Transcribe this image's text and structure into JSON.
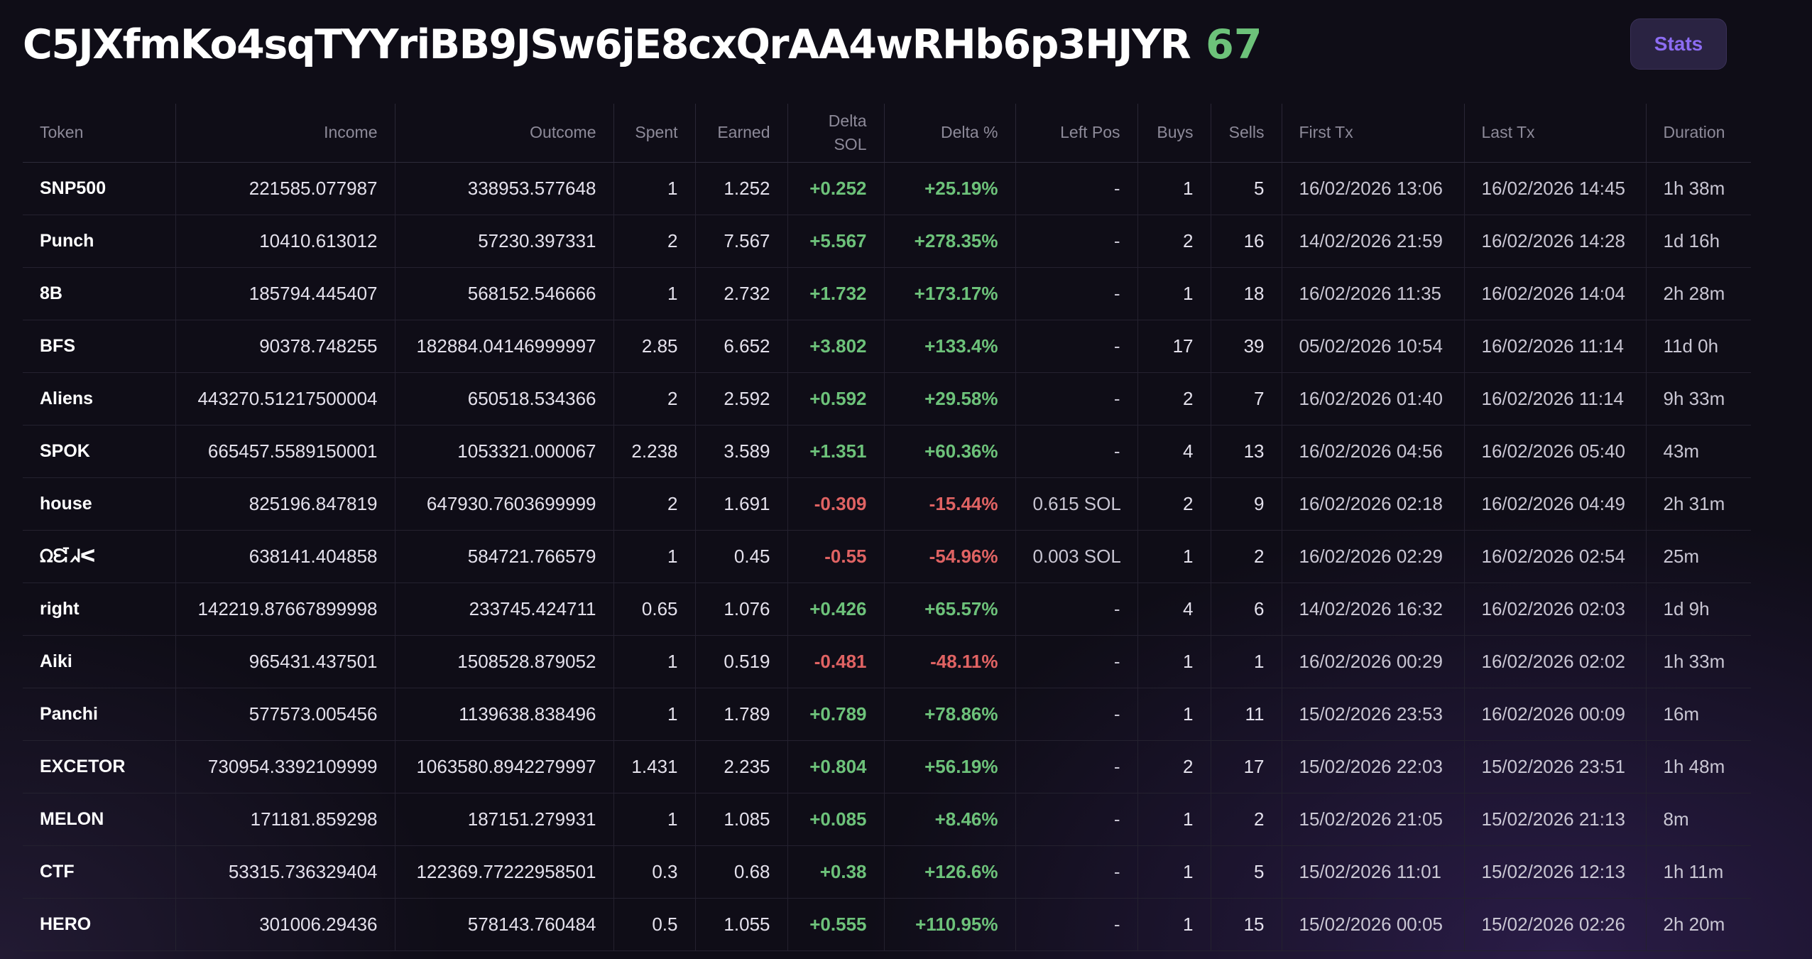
{
  "header": {
    "title": "C5JXfmKo4sqTYYriBB9JSw6jE8cxQrAA4wRHb6p3HJYR",
    "count": "67",
    "stats_label": "Stats"
  },
  "colors": {
    "positive": "#6dc27a",
    "negative": "#e06363",
    "accent": "#8c6cf2",
    "background": "#0f0d17"
  },
  "table": {
    "columns": [
      "Token",
      "Income",
      "Outcome",
      "Spent",
      "Earned",
      "Delta SOL",
      "Delta %",
      "Left Pos",
      "Buys",
      "Sells",
      "First Tx",
      "Last Tx",
      "Duration"
    ],
    "rows": [
      {
        "token": "SNP500",
        "income": "221585.077987",
        "outcome": "338953.577648",
        "spent": "1",
        "earned": "1.252",
        "delta_sol": "+0.252",
        "delta_pct": "+25.19%",
        "left_pos": "-",
        "buys": "1",
        "sells": "5",
        "first_tx": "16/02/2026 13:06",
        "last_tx": "16/02/2026 14:45",
        "duration": "1h 38m",
        "sign": "pos"
      },
      {
        "token": "Punch",
        "income": "10410.613012",
        "outcome": "57230.397331",
        "spent": "2",
        "earned": "7.567",
        "delta_sol": "+5.567",
        "delta_pct": "+278.35%",
        "left_pos": "-",
        "buys": "2",
        "sells": "16",
        "first_tx": "14/02/2026 21:59",
        "last_tx": "16/02/2026 14:28",
        "duration": "1d 16h",
        "sign": "pos"
      },
      {
        "token": "8B",
        "income": "185794.445407",
        "outcome": "568152.546666",
        "spent": "1",
        "earned": "2.732",
        "delta_sol": "+1.732",
        "delta_pct": "+173.17%",
        "left_pos": "-",
        "buys": "1",
        "sells": "18",
        "first_tx": "16/02/2026 11:35",
        "last_tx": "16/02/2026 14:04",
        "duration": "2h 28m",
        "sign": "pos"
      },
      {
        "token": "BFS",
        "income": "90378.748255",
        "outcome": "182884.04146999997",
        "spent": "2.85",
        "earned": "6.652",
        "delta_sol": "+3.802",
        "delta_pct": "+133.4%",
        "left_pos": "-",
        "buys": "17",
        "sells": "39",
        "first_tx": "05/02/2026 10:54",
        "last_tx": "16/02/2026 11:14",
        "duration": "11d 0h",
        "sign": "pos"
      },
      {
        "token": "Aliens",
        "income": "443270.51217500004",
        "outcome": "650518.534366",
        "spent": "2",
        "earned": "2.592",
        "delta_sol": "+0.592",
        "delta_pct": "+29.58%",
        "left_pos": "-",
        "buys": "2",
        "sells": "7",
        "first_tx": "16/02/2026 01:40",
        "last_tx": "16/02/2026 11:14",
        "duration": "9h 33m",
        "sign": "pos"
      },
      {
        "token": "SPOK",
        "income": "665457.5589150001",
        "outcome": "1053321.000067",
        "spent": "2.238",
        "earned": "3.589",
        "delta_sol": "+1.351",
        "delta_pct": "+60.36%",
        "left_pos": "-",
        "buys": "4",
        "sells": "13",
        "first_tx": "16/02/2026 04:56",
        "last_tx": "16/02/2026 05:40",
        "duration": "43m",
        "sign": "pos"
      },
      {
        "token": "house",
        "income": "825196.847819",
        "outcome": "647930.7603699999",
        "spent": "2",
        "earned": "1.691",
        "delta_sol": "-0.309",
        "delta_pct": "-15.44%",
        "left_pos": "0.615 SOL",
        "buys": "2",
        "sells": "9",
        "first_tx": "16/02/2026 02:18",
        "last_tx": "16/02/2026 04:49",
        "duration": "2h 31m",
        "sign": "neg"
      },
      {
        "token": "ᘯᘿᖽᐸ",
        "income": "638141.404858",
        "outcome": "584721.766579",
        "spent": "1",
        "earned": "0.45",
        "delta_sol": "-0.55",
        "delta_pct": "-54.96%",
        "left_pos": "0.003 SOL",
        "buys": "1",
        "sells": "2",
        "first_tx": "16/02/2026 02:29",
        "last_tx": "16/02/2026 02:54",
        "duration": "25m",
        "sign": "neg"
      },
      {
        "token": "right",
        "income": "142219.87667899998",
        "outcome": "233745.424711",
        "spent": "0.65",
        "earned": "1.076",
        "delta_sol": "+0.426",
        "delta_pct": "+65.57%",
        "left_pos": "-",
        "buys": "4",
        "sells": "6",
        "first_tx": "14/02/2026 16:32",
        "last_tx": "16/02/2026 02:03",
        "duration": "1d 9h",
        "sign": "pos"
      },
      {
        "token": "Aiki",
        "income": "965431.437501",
        "outcome": "1508528.879052",
        "spent": "1",
        "earned": "0.519",
        "delta_sol": "-0.481",
        "delta_pct": "-48.11%",
        "left_pos": "-",
        "buys": "1",
        "sells": "1",
        "first_tx": "16/02/2026 00:29",
        "last_tx": "16/02/2026 02:02",
        "duration": "1h 33m",
        "sign": "neg"
      },
      {
        "token": "Panchi",
        "income": "577573.005456",
        "outcome": "1139638.838496",
        "spent": "1",
        "earned": "1.789",
        "delta_sol": "+0.789",
        "delta_pct": "+78.86%",
        "left_pos": "-",
        "buys": "1",
        "sells": "11",
        "first_tx": "15/02/2026 23:53",
        "last_tx": "16/02/2026 00:09",
        "duration": "16m",
        "sign": "pos"
      },
      {
        "token": "EXCETOR",
        "income": "730954.3392109999",
        "outcome": "1063580.8942279997",
        "spent": "1.431",
        "earned": "2.235",
        "delta_sol": "+0.804",
        "delta_pct": "+56.19%",
        "left_pos": "-",
        "buys": "2",
        "sells": "17",
        "first_tx": "15/02/2026 22:03",
        "last_tx": "15/02/2026 23:51",
        "duration": "1h 48m",
        "sign": "pos"
      },
      {
        "token": "MELON",
        "income": "171181.859298",
        "outcome": "187151.279931",
        "spent": "1",
        "earned": "1.085",
        "delta_sol": "+0.085",
        "delta_pct": "+8.46%",
        "left_pos": "-",
        "buys": "1",
        "sells": "2",
        "first_tx": "15/02/2026 21:05",
        "last_tx": "15/02/2026 21:13",
        "duration": "8m",
        "sign": "pos"
      },
      {
        "token": "CTF",
        "income": "53315.736329404",
        "outcome": "122369.77222958501",
        "spent": "0.3",
        "earned": "0.68",
        "delta_sol": "+0.38",
        "delta_pct": "+126.6%",
        "left_pos": "-",
        "buys": "1",
        "sells": "5",
        "first_tx": "15/02/2026 11:01",
        "last_tx": "15/02/2026 12:13",
        "duration": "1h 11m",
        "sign": "pos"
      },
      {
        "token": "HERO",
        "income": "301006.29436",
        "outcome": "578143.760484",
        "spent": "0.5",
        "earned": "1.055",
        "delta_sol": "+0.555",
        "delta_pct": "+110.95%",
        "left_pos": "-",
        "buys": "1",
        "sells": "15",
        "first_tx": "15/02/2026 00:05",
        "last_tx": "15/02/2026 02:26",
        "duration": "2h 20m",
        "sign": "pos"
      }
    ]
  }
}
